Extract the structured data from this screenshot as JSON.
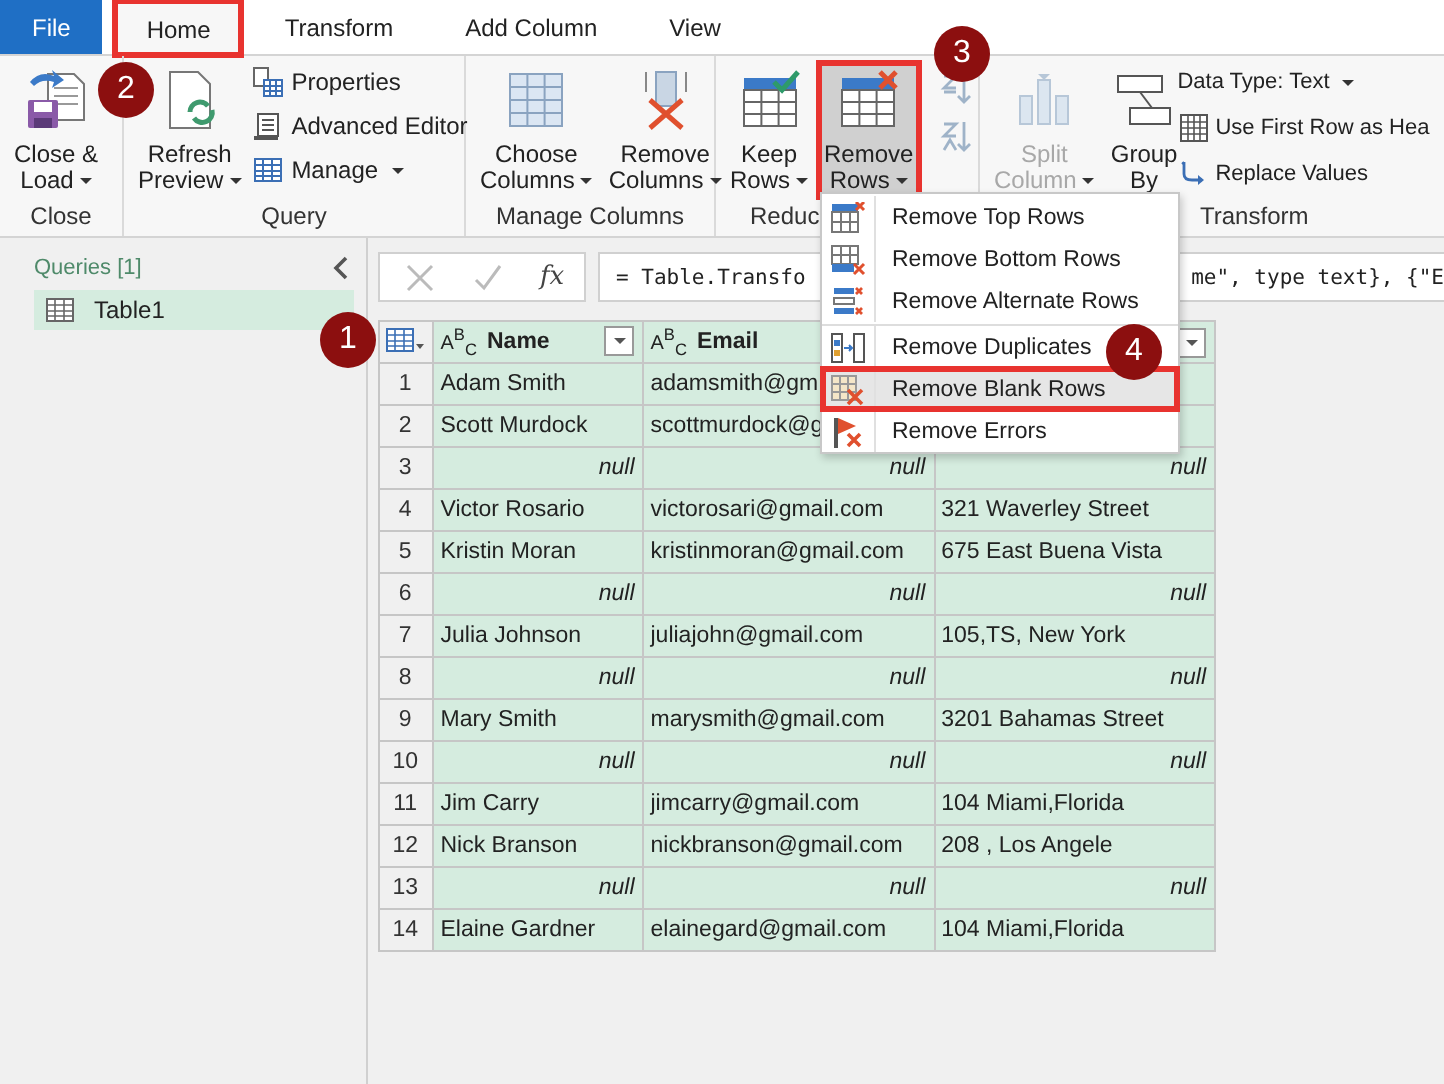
{
  "tabs": [
    {
      "label": "File",
      "kind": "file",
      "selected": false,
      "highlighted": false
    },
    {
      "label": "Home",
      "kind": "tab",
      "selected": true,
      "highlighted": true
    },
    {
      "label": "Transform",
      "kind": "tab",
      "selected": false,
      "highlighted": false
    },
    {
      "label": "Add Column",
      "kind": "tab",
      "selected": false,
      "highlighted": false
    },
    {
      "label": "View",
      "kind": "tab",
      "selected": false,
      "highlighted": false
    }
  ],
  "ribbon": {
    "groups": [
      {
        "label": "Close",
        "items": [
          {
            "lines": [
              "Close &",
              "Load"
            ],
            "dropdown": true
          }
        ]
      },
      {
        "label": "Query",
        "items": [
          {
            "lines": [
              "Refresh",
              "Preview"
            ],
            "dropdown": true
          },
          {
            "lines": [
              "Properties"
            ],
            "dropdown": false
          },
          {
            "lines": [
              "Advanced Editor"
            ],
            "dropdown": false
          },
          {
            "lines": [
              "Manage"
            ],
            "dropdown": true
          }
        ]
      },
      {
        "label": "Manage Columns",
        "items": [
          {
            "lines": [
              "Choose",
              "Columns"
            ],
            "dropdown": true
          },
          {
            "lines": [
              "Remove",
              "Columns"
            ],
            "dropdown": true
          }
        ]
      },
      {
        "label": "Reduc",
        "items": [
          {
            "lines": [
              "Keep",
              "Rows"
            ],
            "dropdown": true,
            "selected": false,
            "highlighted": false
          },
          {
            "lines": [
              "Remove",
              "Rows"
            ],
            "dropdown": true,
            "selected": true,
            "highlighted": true
          }
        ]
      },
      {
        "label": "Transform",
        "items": [
          {
            "lines": [
              "Split",
              "Column"
            ],
            "dropdown": true,
            "disabled": true
          },
          {
            "lines": [
              "Group",
              "By"
            ],
            "dropdown": false,
            "disabled": false
          },
          {
            "lines": [
              "Data Type: Text"
            ],
            "dropdown": true
          },
          {
            "lines": [
              "Use First Row as Hea"
            ],
            "dropdown": false
          },
          {
            "lines": [
              "Replace Values"
            ],
            "dropdown": false
          }
        ]
      }
    ]
  },
  "queries": {
    "title": "Queries [1]",
    "items": [
      {
        "label": "Table1",
        "selected": true
      }
    ]
  },
  "formula": {
    "fx": "fx",
    "text_left": "= Table.Transfo",
    "text_right": "me\", type text}, {\"E"
  },
  "table": {
    "columns": [
      {
        "type_icon": "A$^{B}$$_{C}$",
        "name": "Name",
        "filter_button": true
      },
      {
        "type_icon": "A$^{B}$$_{C}$",
        "name": "Email"
      },
      {
        "filter_button": true
      }
    ],
    "rows": [
      {
        "index": "1",
        "cells": [
          {
            "text": "Adam Smith",
            "kind": "value"
          },
          {
            "text": "adamsmith@gm",
            "kind": "value"
          }
        ]
      },
      {
        "index": "2",
        "cells": [
          {
            "text": "Scott Murdock",
            "kind": "value"
          },
          {
            "text": "scottmurdock@g",
            "kind": "value"
          }
        ]
      },
      {
        "index": "3",
        "cells": [
          {
            "text": "null",
            "kind": "null"
          },
          {
            "text": "null",
            "kind": "null"
          },
          {
            "text": "null",
            "kind": "null"
          }
        ]
      },
      {
        "index": "4",
        "cells": [
          {
            "text": "Victor Rosario",
            "kind": "value"
          },
          {
            "text": "victorosari@gmail.com",
            "kind": "value"
          },
          {
            "text": "321 Waverley Street",
            "kind": "value"
          }
        ]
      },
      {
        "index": "5",
        "cells": [
          {
            "text": "Kristin Moran",
            "kind": "value"
          },
          {
            "text": "kristinmoran@gmail.com",
            "kind": "value"
          },
          {
            "text": "675 East Buena Vista",
            "kind": "value"
          }
        ]
      },
      {
        "index": "6",
        "cells": [
          {
            "text": "null",
            "kind": "null"
          },
          {
            "text": "null",
            "kind": "null"
          },
          {
            "text": "null",
            "kind": "null"
          }
        ]
      },
      {
        "index": "7",
        "cells": [
          {
            "text": "Julia Johnson",
            "kind": "value"
          },
          {
            "text": "juliajohn@gmail.com",
            "kind": "value"
          },
          {
            "text": "105,TS, New York",
            "kind": "value"
          }
        ]
      },
      {
        "index": "8",
        "cells": [
          {
            "text": "null",
            "kind": "null"
          },
          {
            "text": "null",
            "kind": "null"
          },
          {
            "text": "null",
            "kind": "null"
          }
        ]
      },
      {
        "index": "9",
        "cells": [
          {
            "text": "Mary Smith",
            "kind": "value"
          },
          {
            "text": "marysmith@gmail.com",
            "kind": "value"
          },
          {
            "text": "3201 Bahamas Street",
            "kind": "value"
          }
        ]
      },
      {
        "index": "10",
        "cells": [
          {
            "text": "null",
            "kind": "null"
          },
          {
            "text": "null",
            "kind": "null"
          },
          {
            "text": "null",
            "kind": "null"
          }
        ]
      },
      {
        "index": "11",
        "cells": [
          {
            "text": "Jim Carry",
            "kind": "value"
          },
          {
            "text": "jimcarry@gmail.com",
            "kind": "value"
          },
          {
            "text": "104 Miami,Florida",
            "kind": "value"
          }
        ]
      },
      {
        "index": "12",
        "cells": [
          {
            "text": "Nick Branson",
            "kind": "value"
          },
          {
            "text": "nickbranson@gmail.com",
            "kind": "value"
          },
          {
            "text": "208 , Los Angele",
            "kind": "value"
          }
        ]
      },
      {
        "index": "13",
        "cells": [
          {
            "text": "null",
            "kind": "null"
          },
          {
            "text": "null",
            "kind": "null"
          },
          {
            "text": "null",
            "kind": "null"
          }
        ]
      },
      {
        "index": "14",
        "cells": [
          {
            "text": "Elaine Gardner",
            "kind": "value"
          },
          {
            "text": "elainegard@gmail.com",
            "kind": "value"
          },
          {
            "text": "104 Miami,Florida",
            "kind": "value"
          }
        ]
      }
    ]
  },
  "menu": {
    "items": [
      {
        "label": "Remove Top Rows",
        "selected": false,
        "highlighted": false,
        "separator_before": false
      },
      {
        "label": "Remove Bottom Rows",
        "selected": false,
        "highlighted": false,
        "separator_before": false
      },
      {
        "label": "Remove Alternate Rows",
        "selected": false,
        "highlighted": false,
        "separator_before": false
      },
      {
        "label": "Remove Duplicates",
        "selected": false,
        "highlighted": false,
        "separator_before": true
      },
      {
        "label": "Remove Blank Rows",
        "selected": true,
        "highlighted": true,
        "separator_before": false
      },
      {
        "label": "Remove Errors",
        "selected": false,
        "highlighted": false,
        "separator_before": false
      }
    ]
  },
  "annotations": [
    {
      "label": "1"
    },
    {
      "label": "2"
    },
    {
      "label": "3"
    },
    {
      "label": "4"
    }
  ]
}
